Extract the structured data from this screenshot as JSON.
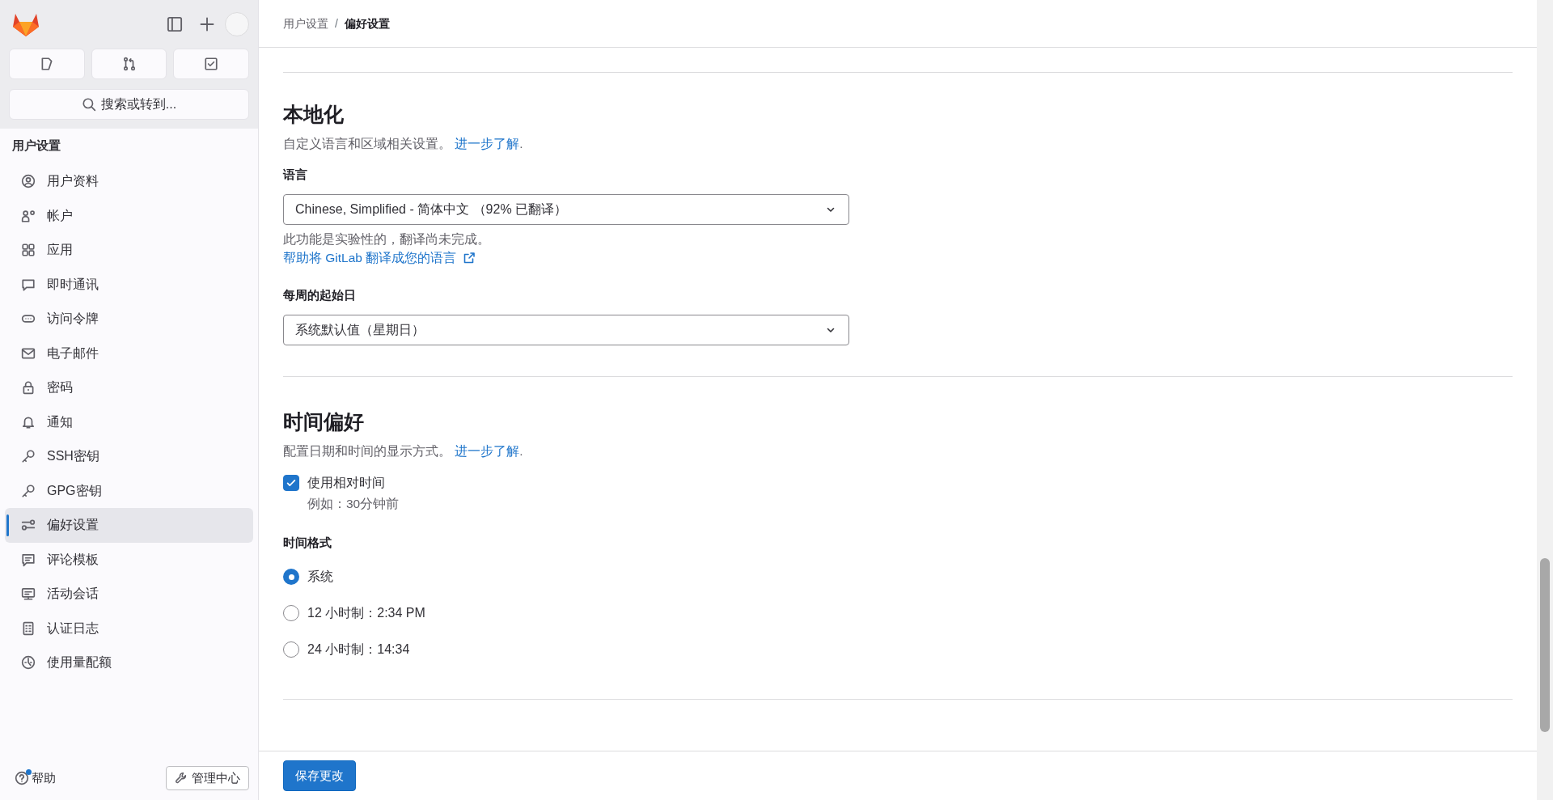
{
  "sidebar": {
    "quick_actions": [
      {
        "kind": "issues"
      },
      {
        "kind": "merge_requests"
      },
      {
        "kind": "todos"
      }
    ],
    "search_button": "搜索或转到...",
    "section_title": "用户设置",
    "items": [
      {
        "label": "用户资料",
        "selected": false
      },
      {
        "label": "帐户",
        "selected": false
      },
      {
        "label": "应用",
        "selected": false
      },
      {
        "label": "即时通讯",
        "selected": false
      },
      {
        "label": "访问令牌",
        "selected": false
      },
      {
        "label": "电子邮件",
        "selected": false
      },
      {
        "label": "密码",
        "selected": false
      },
      {
        "label": "通知",
        "selected": false
      },
      {
        "label": "SSH密钥",
        "selected": false
      },
      {
        "label": "GPG密钥",
        "selected": false
      },
      {
        "label": "偏好设置",
        "selected": true
      },
      {
        "label": "评论模板",
        "selected": false
      },
      {
        "label": "活动会话",
        "selected": false
      },
      {
        "label": "认证日志",
        "selected": false
      },
      {
        "label": "使用量配额",
        "selected": false
      }
    ],
    "help": "帮助",
    "admin_button": "管理中心"
  },
  "breadcrumb": {
    "separator": "/",
    "items": [
      {
        "label": "用户设置",
        "current": false
      },
      {
        "label": "偏好设置",
        "current": true
      }
    ]
  },
  "sections": [
    {
      "title": "本地化",
      "description": "自定义语言和区域相关设置。",
      "link": "进一步了解",
      "link_suffix": ".",
      "fields": [
        {
          "kind": "select",
          "label": "语言",
          "value": "Chinese, Simplified - 简体中文 （92% 已翻译）",
          "help": "此功能是实验性的，翻译尚未完成。",
          "help_link": "帮助将 GitLab 翻译成您的语言"
        },
        {
          "kind": "select",
          "label": "每周的起始日",
          "value": "系统默认值（星期日）"
        }
      ]
    },
    {
      "title": "时间偏好",
      "description": "配置日期和时间的显示方式。",
      "link": "进一步了解",
      "link_suffix": ".",
      "fields": [
        {
          "kind": "checkbox",
          "label": "使用相对时间",
          "help": "例如：30分钟前",
          "checked": true
        },
        {
          "kind": "radio",
          "label": "时间格式",
          "options": [
            {
              "label": "系统",
              "selected": true
            },
            {
              "label": "12 小时制：2:34 PM",
              "selected": false
            },
            {
              "label": "24 小时制：14:34",
              "selected": false
            }
          ]
        }
      ]
    }
  ],
  "save_button": "保存更改"
}
